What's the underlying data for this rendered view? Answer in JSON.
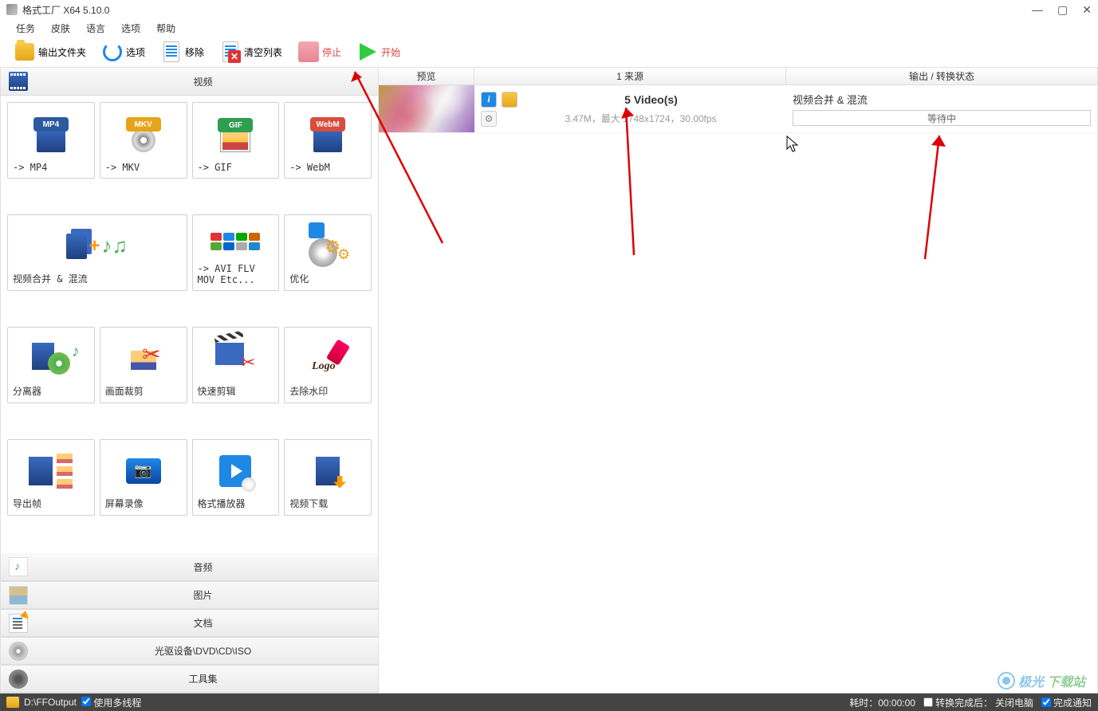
{
  "window": {
    "title": "格式工厂 X64 5.10.0"
  },
  "menu": {
    "task": "任务",
    "skin": "皮肤",
    "lang": "语言",
    "opts": "选项",
    "help": "帮助"
  },
  "toolbar": {
    "output": "输出文件夹",
    "opts": "选项",
    "remove": "移除",
    "clear": "清空列表",
    "stop": "停止",
    "start": "开始"
  },
  "categories": {
    "video": "视频",
    "audio": "音频",
    "image": "图片",
    "doc": "文档",
    "disc": "光驱设备\\DVD\\CD\\ISO",
    "tools": "工具集"
  },
  "tiles": {
    "mp4": "-> MP4",
    "mkv": "-> MKV",
    "gif": "-> GIF",
    "webm": "-> WebM",
    "merge": "视频合并 & 混流",
    "multi": "-> AVI FLV MOV Etc...",
    "optimize": "优化",
    "separate": "分离器",
    "crop": "画面裁剪",
    "quick": "快速剪辑",
    "watermark": "去除水印",
    "export": "导出帧",
    "record": "屏幕录像",
    "player": "格式播放器",
    "download": "视频下载",
    "fmt": {
      "mp4": "MP4",
      "mkv": "MKV",
      "gif": "GIF",
      "webm": "WebM"
    },
    "logo": "Logo"
  },
  "table": {
    "headers": {
      "preview": "预览",
      "source": "1 来源",
      "output": "输出 / 转换状态"
    },
    "row": {
      "title": "5 Video(s)",
      "sub": "3.47M，最大 1748x1724，30.00fps",
      "op": "视频合并 & 混流",
      "status": "等待中"
    }
  },
  "status": {
    "path": "D:\\FFOutput",
    "multithread": "使用多线程",
    "elapsed_label": "耗时：",
    "elapsed": "00:00:00",
    "after_label": "转换完成后：",
    "after_val": "关闭电脑",
    "notify": "完成通知"
  },
  "watermark": {
    "p1": "极光",
    "p2": "下载站"
  }
}
